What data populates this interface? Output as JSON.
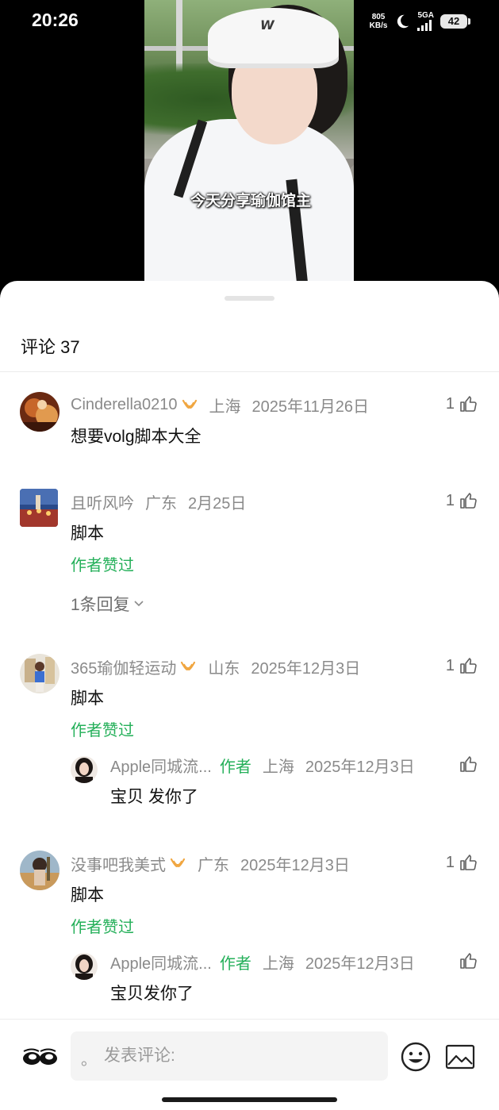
{
  "status_bar": {
    "time": "20:26",
    "net_speed_value": "805",
    "net_speed_unit": "KB/s",
    "network": "5GA",
    "battery": "42"
  },
  "video": {
    "caption": "今天分享瑜伽馆主",
    "visor_logo": "W"
  },
  "comments_panel": {
    "title": "评论 37",
    "comments": [
      {
        "username": "Cinderella0210",
        "location": "上海",
        "date": "2025年11月26日",
        "text": "想要volg脚本大全",
        "likes": "1"
      },
      {
        "username": "且听风吟",
        "location": "广东",
        "date": "2月25日",
        "text": "脚本",
        "likes": "1",
        "author_liked": "作者赞过",
        "replies_link": "1条回复"
      },
      {
        "username": "365瑜伽轻运动",
        "location": "山东",
        "date": "2025年12月3日",
        "text": "脚本",
        "likes": "1",
        "author_liked": "作者赞过",
        "reply": {
          "username": "Apple同城流...",
          "author_tag": "作者",
          "location": "上海",
          "date": "2025年12月3日",
          "text": "宝贝 发你了"
        }
      },
      {
        "username": "没事吧我美式",
        "location": "广东",
        "date": "2025年12月3日",
        "text": "脚本",
        "likes": "1",
        "author_liked": "作者赞过",
        "reply": {
          "username": "Apple同城流...",
          "author_tag": "作者",
          "location": "上海",
          "date": "2025年12月3日",
          "text": "宝贝发你了"
        }
      }
    ]
  },
  "input_bar": {
    "placeholder": "发表评论:",
    "prefix_dot": "。"
  },
  "colors": {
    "author_green": "#25b05a",
    "badge_gold": "#f0a640",
    "meta_gray": "#8a8a8a"
  },
  "icons": [
    "thumbs-up-icon",
    "gold-badge-icon",
    "chevron-down-icon",
    "emoji-icon",
    "image-icon",
    "moon-icon",
    "signal-icon",
    "battery-icon"
  ]
}
